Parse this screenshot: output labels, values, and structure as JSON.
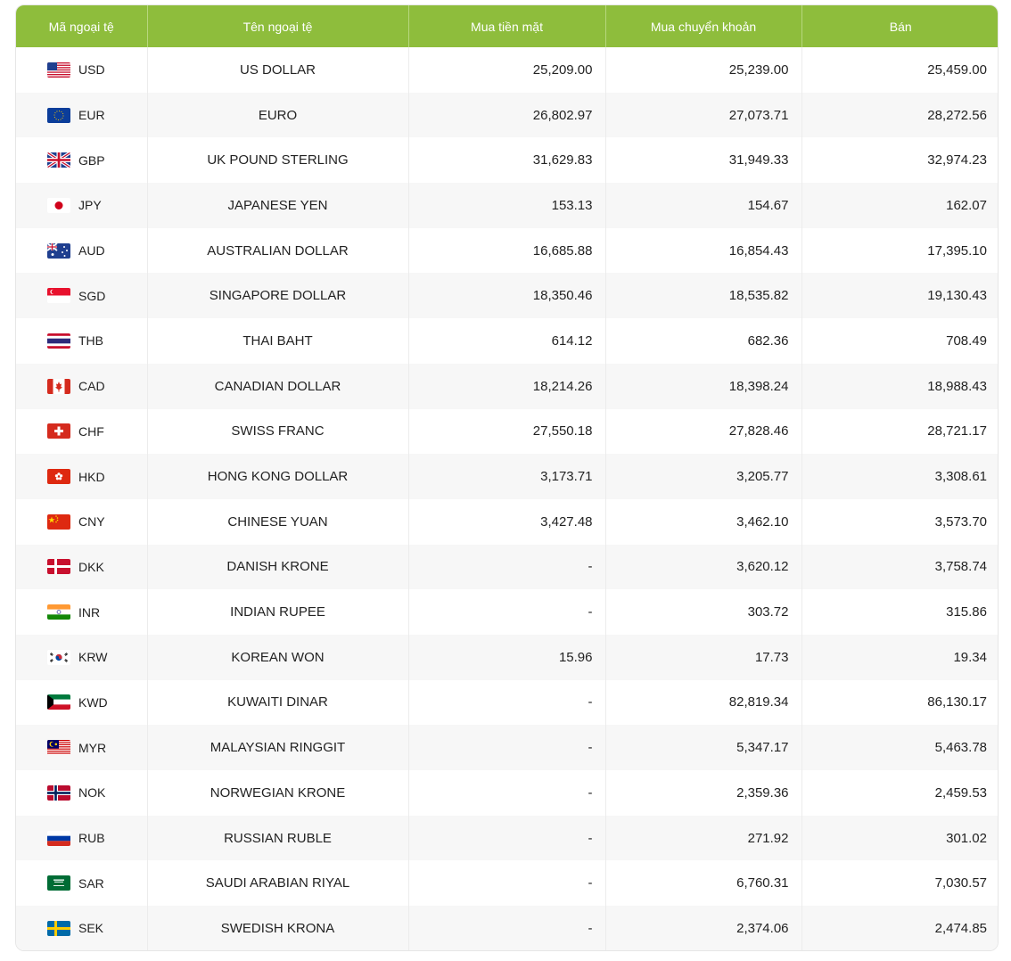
{
  "table": {
    "headers": {
      "code": "Mã ngoại tệ",
      "name": "Tên ngoại tệ",
      "buy_cash": "Mua tiền mặt",
      "buy_transfer": "Mua chuyển khoản",
      "sell": "Bán"
    },
    "header_color": "#8ebd3c",
    "rows": [
      {
        "code": "USD",
        "flag": "us-flag-icon",
        "name": "US DOLLAR",
        "buy_cash": "25,209.00",
        "buy_transfer": "25,239.00",
        "sell": "25,459.00"
      },
      {
        "code": "EUR",
        "flag": "eu-flag-icon",
        "name": "EURO",
        "buy_cash": "26,802.97",
        "buy_transfer": "27,073.71",
        "sell": "28,272.56"
      },
      {
        "code": "GBP",
        "flag": "uk-flag-icon",
        "name": "UK POUND STERLING",
        "buy_cash": "31,629.83",
        "buy_transfer": "31,949.33",
        "sell": "32,974.23"
      },
      {
        "code": "JPY",
        "flag": "japan-flag-icon",
        "name": "JAPANESE YEN",
        "buy_cash": "153.13",
        "buy_transfer": "154.67",
        "sell": "162.07"
      },
      {
        "code": "AUD",
        "flag": "australia-flag-icon",
        "name": "AUSTRALIAN DOLLAR",
        "buy_cash": "16,685.88",
        "buy_transfer": "16,854.43",
        "sell": "17,395.10"
      },
      {
        "code": "SGD",
        "flag": "singapore-flag-icon",
        "name": "SINGAPORE DOLLAR",
        "buy_cash": "18,350.46",
        "buy_transfer": "18,535.82",
        "sell": "19,130.43"
      },
      {
        "code": "THB",
        "flag": "thailand-flag-icon",
        "name": "THAI BAHT",
        "buy_cash": "614.12",
        "buy_transfer": "682.36",
        "sell": "708.49"
      },
      {
        "code": "CAD",
        "flag": "canada-flag-icon",
        "name": "CANADIAN DOLLAR",
        "buy_cash": "18,214.26",
        "buy_transfer": "18,398.24",
        "sell": "18,988.43"
      },
      {
        "code": "CHF",
        "flag": "switzerland-flag-icon",
        "name": "SWISS FRANC",
        "buy_cash": "27,550.18",
        "buy_transfer": "27,828.46",
        "sell": "28,721.17"
      },
      {
        "code": "HKD",
        "flag": "hongkong-flag-icon",
        "name": "HONG KONG DOLLAR",
        "buy_cash": "3,173.71",
        "buy_transfer": "3,205.77",
        "sell": "3,308.61"
      },
      {
        "code": "CNY",
        "flag": "china-flag-icon",
        "name": "CHINESE YUAN",
        "buy_cash": "3,427.48",
        "buy_transfer": "3,462.10",
        "sell": "3,573.70"
      },
      {
        "code": "DKK",
        "flag": "denmark-flag-icon",
        "name": "DANISH KRONE",
        "buy_cash": "-",
        "buy_transfer": "3,620.12",
        "sell": "3,758.74"
      },
      {
        "code": "INR",
        "flag": "india-flag-icon",
        "name": "INDIAN RUPEE",
        "buy_cash": "-",
        "buy_transfer": "303.72",
        "sell": "315.86"
      },
      {
        "code": "KRW",
        "flag": "korea-flag-icon",
        "name": "KOREAN WON",
        "buy_cash": "15.96",
        "buy_transfer": "17.73",
        "sell": "19.34"
      },
      {
        "code": "KWD",
        "flag": "kuwait-flag-icon",
        "name": "KUWAITI DINAR",
        "buy_cash": "-",
        "buy_transfer": "82,819.34",
        "sell": "86,130.17"
      },
      {
        "code": "MYR",
        "flag": "malaysia-flag-icon",
        "name": "MALAYSIAN RINGGIT",
        "buy_cash": "-",
        "buy_transfer": "5,347.17",
        "sell": "5,463.78"
      },
      {
        "code": "NOK",
        "flag": "norway-flag-icon",
        "name": "NORWEGIAN KRONE",
        "buy_cash": "-",
        "buy_transfer": "2,359.36",
        "sell": "2,459.53"
      },
      {
        "code": "RUB",
        "flag": "russia-flag-icon",
        "name": "RUSSIAN RUBLE",
        "buy_cash": "-",
        "buy_transfer": "271.92",
        "sell": "301.02"
      },
      {
        "code": "SAR",
        "flag": "saudi-flag-icon",
        "name": "SAUDI ARABIAN RIYAL",
        "buy_cash": "-",
        "buy_transfer": "6,760.31",
        "sell": "7,030.57"
      },
      {
        "code": "SEK",
        "flag": "sweden-flag-icon",
        "name": "SWEDISH KRONA",
        "buy_cash": "-",
        "buy_transfer": "2,374.06",
        "sell": "2,474.85"
      }
    ]
  }
}
